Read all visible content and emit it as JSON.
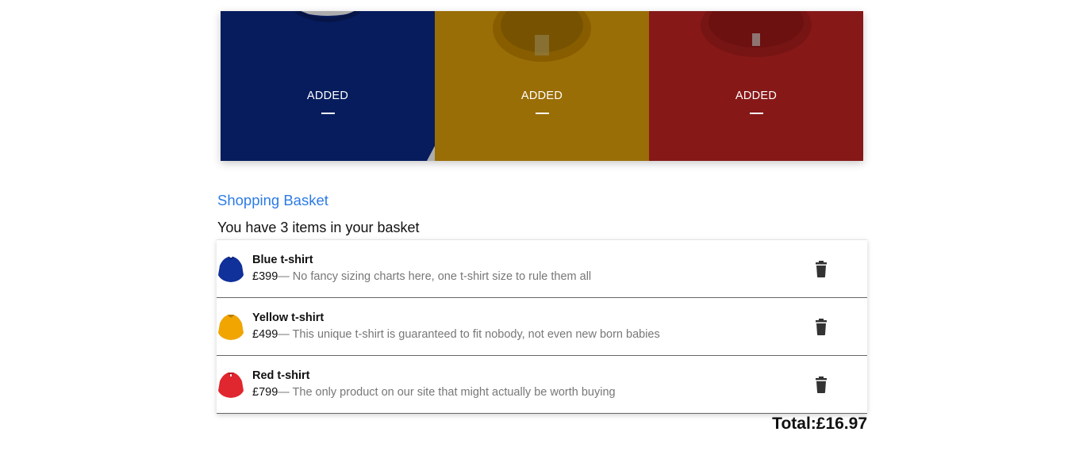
{
  "products": [
    {
      "caption": "ADDED",
      "color": "#0b2a8a",
      "collar": "#08206a"
    },
    {
      "caption": "ADDED",
      "color": "#e3a20a",
      "collar": "#c98a00"
    },
    {
      "caption": "ADDED",
      "color": "#c82424",
      "collar": "#a81a1a"
    }
  ],
  "basket": {
    "title": "Shopping Basket",
    "count_text": "You have 3 items in your basket",
    "items": [
      {
        "name": "Blue t-shirt",
        "price": "£399",
        "description": "— No fancy sizing charts here, one t-shirt size to rule them all",
        "color": "#10309a",
        "icon": "trash-icon"
      },
      {
        "name": "Yellow t-shirt",
        "price": "£499",
        "description": "— This unique t-shirt is guaranteed to fit nobody, not even new born babies",
        "color": "#f0a500",
        "icon": "trash-icon"
      },
      {
        "name": "Red t-shirt",
        "price": "£799",
        "description": "— The only product on our site that might actually be worth buying",
        "color": "#e0262e",
        "icon": "trash-icon"
      }
    ],
    "total": "Total:£16.97"
  }
}
